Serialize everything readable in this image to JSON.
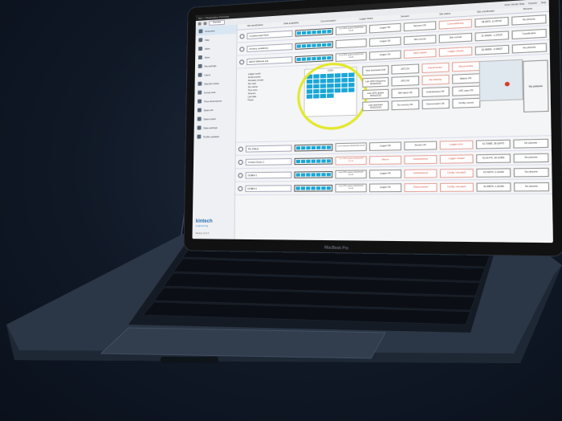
{
  "window": {
    "title": "Site — Registration Overview"
  },
  "toolbar": {
    "field_value": "Overview",
    "right_items": [
      "Enter Vendor Data",
      "Transfer",
      "Help"
    ]
  },
  "sidebar": {
    "items": [
      {
        "label": "Overview",
        "active": true
      },
      {
        "label": "Map"
      },
      {
        "label": "Sites"
      },
      {
        "label": "Sites"
      },
      {
        "label": "Recordings"
      },
      {
        "label": "Users"
      },
      {
        "label": "Species setup"
      },
      {
        "label": "Group sets"
      },
      {
        "label": "Time dimensions"
      },
      {
        "label": "Data info"
      },
      {
        "label": "Data import"
      },
      {
        "label": "Data settings"
      },
      {
        "label": "Profile updates"
      }
    ],
    "logo_name": "kintech",
    "logo_sub": "engineering",
    "version": "Version 1.0.0.X"
  },
  "columns": [
    "Site identification",
    "Data availability",
    "Communication",
    "Logger status",
    "Sensors",
    "Site status",
    "Site coordinates",
    "Pictures"
  ],
  "rows": [
    {
      "name": "Crowborough Farm",
      "comm": "Last GPS update\n05/02/2019 10:23",
      "logger": "Logger OK",
      "sensors": "Sensors OK",
      "status": "Commissioning",
      "status_red": true,
      "coords": "48.2875, 11.45722",
      "pics": "No pictures"
    },
    {
      "name": "Ambury Landsbury",
      "comm": "",
      "logger": "Logger OK",
      "sensors": "Site normal",
      "status": "Site normal",
      "status_red": false,
      "coords": "31.40025, -1.23115",
      "pics": "Coordinates"
    },
    {
      "name": "DEVS Wilfrede site",
      "comm": "Last GPS update\n05/02/2019 14:35",
      "logger": "Logger OK",
      "sensors": "Alarm raised",
      "status": "Logger missed",
      "status_red": true,
      "coords": "39.48896, -0.38027",
      "pics": "No pictures"
    }
  ],
  "expanded": {
    "info_lines": [
      "Logger model",
      "Serial number",
      "Firmware version",
      "Sim card",
      "Sim carrier",
      "Time zone",
      "Antenna",
      "Last data",
      "Power"
    ],
    "calendar_title": "2019",
    "buttons": [
      {
        "label": "Next download\n1AM",
        "red": false
      },
      {
        "label": "GPS OK",
        "red": false
      },
      {
        "label": "Disconnected",
        "red": true
      },
      {
        "label": "Disconnected",
        "red": true
      },
      {
        "label": "Last GPS Frequency\n05/02/2019",
        "red": false
      },
      {
        "label": "GPS OK",
        "red": false
      },
      {
        "label": "Site warning",
        "red": true
      },
      {
        "label": "Battery OK",
        "red": false
      },
      {
        "label": "Last GPS update\n05/02/2019",
        "red": false
      },
      {
        "label": "SIM status OK",
        "red": false
      },
      {
        "label": "Instantaneous OK",
        "red": false
      },
      {
        "label": "UPC open OK",
        "red": false
      },
      {
        "label": "Last download\n05/02/2019",
        "red": false
      },
      {
        "label": "No memory OK",
        "red": false
      },
      {
        "label": "Anemometers OK",
        "red": false
      },
      {
        "label": "Config. events",
        "red": false
      }
    ],
    "pics": "No pictures"
  },
  "rows2": [
    {
      "name": "PA_FIELD",
      "comm": "Last evolution\n05/02/2019 10:23",
      "logger": "Logger OK",
      "sensors": "Sensor OK",
      "status": "Logger error",
      "status_red": true,
      "coords": "41.79985, 38.62473",
      "pics": "No pictures"
    },
    {
      "name": "Crowne Down 1",
      "comm": "Last GPS update\n05/02/2019 10:23",
      "logger": "Alarms",
      "sensors": "Instantaneous",
      "status": "Logger missed",
      "status_red": true,
      "coords": "41.61475, 18.12356",
      "pics": "No pictures"
    },
    {
      "name": "DOBIN 1",
      "comm": "Last GPS update\n05/02/2019 10:23",
      "logger": "Logger OK",
      "sensors": "Instantaneous",
      "status": "Config. mismatch",
      "status_red": true,
      "coords": "41.51070, 2.21000",
      "pics": "No pictures"
    },
    {
      "name": "DOBIN 2",
      "comm": "Last GPS update\n05/02/2019 10:23",
      "logger": "Logger OK",
      "sensors": "Disconnected",
      "status": "Config. mismatch",
      "status_red": true,
      "coords": "41.56870, 2.21050",
      "pics": "No pictures"
    }
  ],
  "laptop": {
    "brand_label": "MacBook Pro"
  }
}
